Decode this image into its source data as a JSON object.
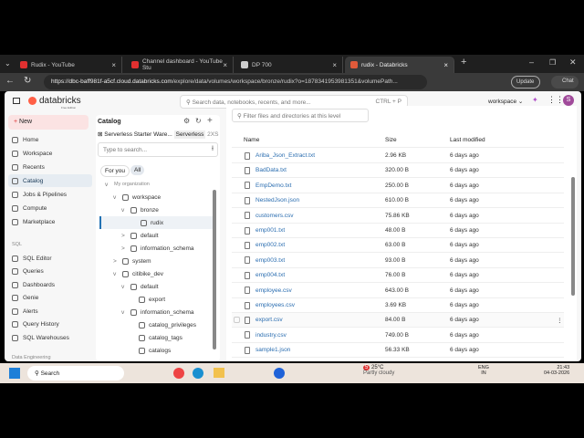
{
  "browser": {
    "tabs": [
      {
        "label": "Rudix - YouTube",
        "color": "#e03030"
      },
      {
        "label": "Channel dashboard - YouTube Stu",
        "color": "#e03030"
      },
      {
        "label": "DP 700",
        "color": "#ccc"
      },
      {
        "label": "rudix - Databricks",
        "color": "#e05a3a"
      }
    ],
    "url_host": "https://dbc-baff981f-a5cf.cloud.databricks.com",
    "url_path": "/explore/data/volumes/workspace/bronze/rudix?o=1878341953981351&volumePath...",
    "update_label": "Update",
    "chat_label": "Chat"
  },
  "header": {
    "logo": "databricks",
    "logo_sub": "Free Edition",
    "search_placeholder": "Search data, notebooks, recents, and more...",
    "search_shortcut": "CTRL + P",
    "workspace": "workspace",
    "avatar": "S"
  },
  "sidebar": {
    "new_label": "New",
    "items": [
      {
        "label": "Home"
      },
      {
        "label": "Workspace"
      },
      {
        "label": "Recents"
      },
      {
        "label": "Catalog",
        "active": true
      },
      {
        "label": "Jobs & Pipelines"
      },
      {
        "label": "Compute"
      },
      {
        "label": "Marketplace"
      }
    ],
    "sql_section": "SQL",
    "sql_items": [
      {
        "label": "SQL Editor"
      },
      {
        "label": "Queries"
      },
      {
        "label": "Dashboards"
      },
      {
        "label": "Genie"
      },
      {
        "label": "Alerts"
      },
      {
        "label": "Query History"
      },
      {
        "label": "SQL Warehouses"
      }
    ],
    "de_section": "Data Engineering"
  },
  "catalog": {
    "title": "Catalog",
    "warehouse": "Serverless Starter Ware...",
    "warehouse_type": "Serverless",
    "warehouse_size": "2XS",
    "search_placeholder": "Type to search...",
    "filters": [
      "For you",
      "All"
    ],
    "tree": [
      {
        "label": "My organization",
        "depth": 0,
        "caret": "v"
      },
      {
        "label": "workspace",
        "depth": 1,
        "caret": "v"
      },
      {
        "label": "bronze",
        "depth": 2,
        "caret": "v"
      },
      {
        "label": "rudix",
        "depth": 3,
        "caret": "",
        "selected": true
      },
      {
        "label": "default",
        "depth": 2,
        "caret": ">"
      },
      {
        "label": "information_schema",
        "depth": 2,
        "caret": ">"
      },
      {
        "label": "system",
        "depth": 1,
        "caret": ">"
      },
      {
        "label": "citibike_dev",
        "depth": 1,
        "caret": "v"
      },
      {
        "label": "default",
        "depth": 2,
        "caret": "v"
      },
      {
        "label": "export",
        "depth": 3,
        "caret": ""
      },
      {
        "label": "information_schema",
        "depth": 2,
        "caret": "v"
      },
      {
        "label": "catalog_privileges",
        "depth": 3,
        "caret": ""
      },
      {
        "label": "catalog_tags",
        "depth": 3,
        "caret": ""
      },
      {
        "label": "catalogs",
        "depth": 3,
        "caret": ""
      }
    ]
  },
  "files": {
    "filter_placeholder": "Filter files and directories at this level",
    "columns": [
      "Name",
      "Size",
      "Last modified"
    ],
    "rows": [
      {
        "name": "Ariba_Json_Extract.txt",
        "size": "2.96 KB",
        "modified": "6 days ago"
      },
      {
        "name": "BadData.txt",
        "size": "320.00 B",
        "modified": "6 days ago"
      },
      {
        "name": "EmpDemo.txt",
        "size": "250.00 B",
        "modified": "6 days ago"
      },
      {
        "name": "NestedJson.json",
        "size": "610.00 B",
        "modified": "6 days ago"
      },
      {
        "name": "customers.csv",
        "size": "75.86 KB",
        "modified": "6 days ago"
      },
      {
        "name": "emp001.txt",
        "size": "48.00 B",
        "modified": "6 days ago"
      },
      {
        "name": "emp002.txt",
        "size": "63.00 B",
        "modified": "6 days ago"
      },
      {
        "name": "emp003.txt",
        "size": "93.00 B",
        "modified": "6 days ago"
      },
      {
        "name": "emp004.txt",
        "size": "76.00 B",
        "modified": "6 days ago"
      },
      {
        "name": "employee.csv",
        "size": "643.00 B",
        "modified": "6 days ago"
      },
      {
        "name": "employees.csv",
        "size": "3.69 KB",
        "modified": "6 days ago"
      },
      {
        "name": "export.csv",
        "size": "84.00 B",
        "modified": "6 days ago",
        "hover": true
      },
      {
        "name": "industry.csv",
        "size": "749.00 B",
        "modified": "6 days ago"
      },
      {
        "name": "sample1.json",
        "size": "56.33 KB",
        "modified": "6 days ago"
      }
    ]
  },
  "taskbar": {
    "search": "Search",
    "weather_temp": "25°C",
    "weather_desc": "Partly cloudy",
    "weather_badge": "5",
    "lang": "ENG",
    "region": "IN",
    "time": "21:43",
    "date": "04-03-2026"
  }
}
